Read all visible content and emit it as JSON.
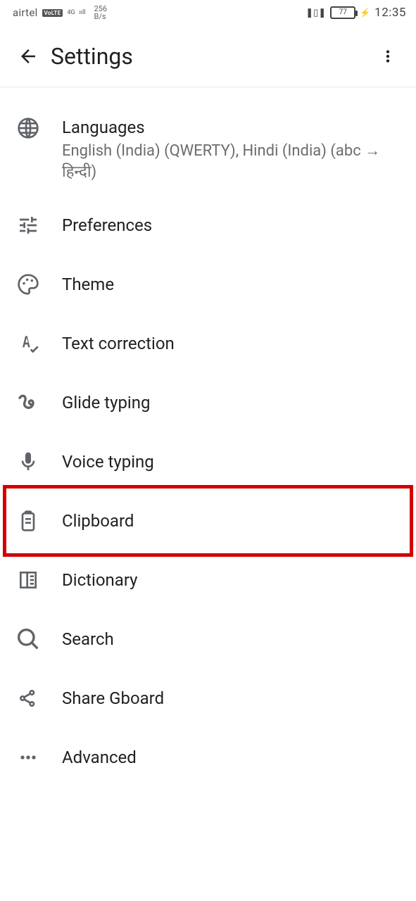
{
  "statusbar": {
    "carrier": "airtel",
    "volte": "VoLTE",
    "network_gen": "4G",
    "signal_glyph": "ııll",
    "net_speed_num": "256",
    "net_speed_unit": "B/s",
    "vibrate_glyph": "❚▯❚",
    "battery_pct": "77",
    "charging_glyph": "⚡",
    "time": "12:35"
  },
  "appbar": {
    "title": "Settings"
  },
  "items": [
    {
      "id": "languages",
      "title": "Languages",
      "sub": "English (India) (QWERTY), Hindi (India) (abc → हिन्दी)"
    },
    {
      "id": "preferences",
      "title": "Preferences"
    },
    {
      "id": "theme",
      "title": "Theme"
    },
    {
      "id": "text_corr",
      "title": "Text correction"
    },
    {
      "id": "glide",
      "title": "Glide typing"
    },
    {
      "id": "voice",
      "title": "Voice typing"
    },
    {
      "id": "clipboard",
      "title": "Clipboard"
    },
    {
      "id": "dictionary",
      "title": "Dictionary"
    },
    {
      "id": "search",
      "title": "Search"
    },
    {
      "id": "share",
      "title": "Share Gboard"
    },
    {
      "id": "advanced",
      "title": "Advanced"
    }
  ],
  "highlight_item_id": "clipboard",
  "annotation_color": "#d20000"
}
